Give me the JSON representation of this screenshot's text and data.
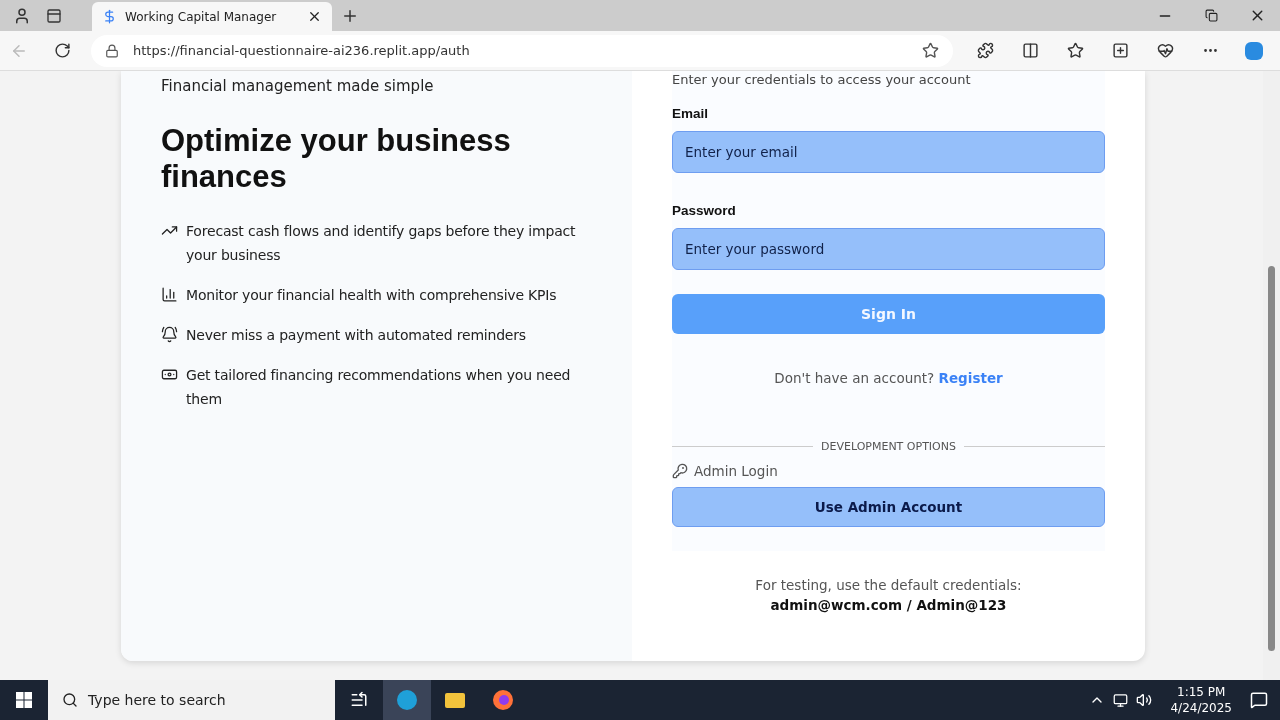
{
  "browser": {
    "tab": {
      "title": "Working Capital Manager",
      "selected": true
    },
    "url": "https://financial-questionnaire-ai236.replit.app/auth"
  },
  "hero": {
    "tagline": "Financial management made simple",
    "heading": "Optimize your business finances",
    "features": [
      {
        "kind": "trend",
        "text": "Forecast cash flows and identify gaps before they impact your business"
      },
      {
        "kind": "chart",
        "text": "Monitor your financial health with comprehensive KPIs"
      },
      {
        "kind": "bell",
        "text": "Never miss a payment with automated reminders"
      },
      {
        "kind": "money",
        "text": "Get tailored financing recommendations when you need them"
      }
    ]
  },
  "login": {
    "subtitle": "Enter your credentials to access your account",
    "fields": [
      {
        "label": "Email",
        "placeholder": "Enter your email"
      },
      {
        "label": "Password",
        "placeholder": "Enter your password"
      }
    ],
    "submit": "Sign In",
    "register_prompt": "Don't have an account?",
    "register_link": "Register",
    "dev_heading": "DEVELOPMENT OPTIONS",
    "admin_label": "Admin Login",
    "admin_button": "Use Admin Account",
    "testing_note": "For testing, use the default credentials:",
    "credentials": "admin@wcm.com / Admin@123"
  },
  "taskbar": {
    "search_placeholder": "Type here to search",
    "time": "1:15 PM",
    "date": "4/24/2025"
  }
}
